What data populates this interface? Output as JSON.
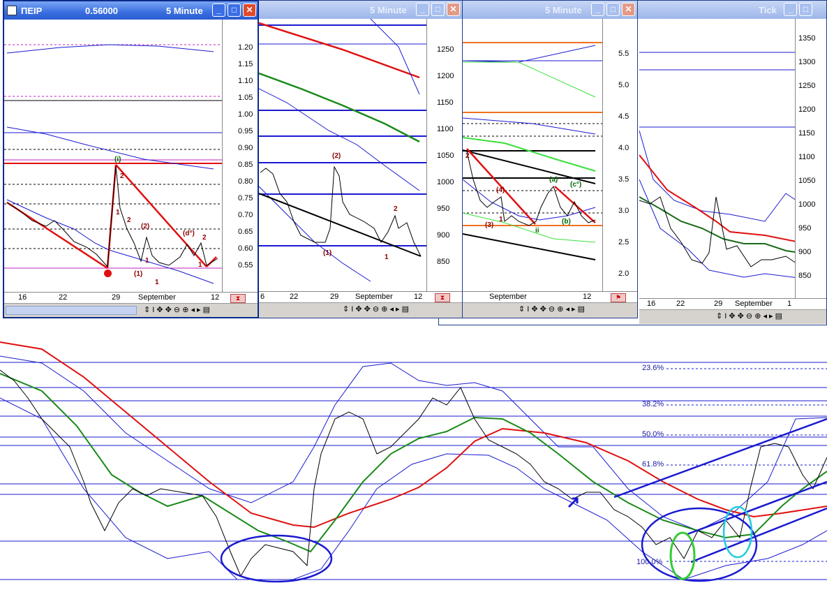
{
  "windows": [
    {
      "title": "ΠΕΙΡ",
      "price": "0.56000",
      "interval": "5 Minute",
      "yaxis": [
        "1.20",
        "1.15",
        "1.10",
        "1.05",
        "1.00",
        "0.95",
        "0.90",
        "0.85",
        "0.80",
        "0.75",
        "0.70",
        "0.65",
        "0.60",
        "0.55"
      ],
      "xaxis": [
        "16",
        "22",
        "29",
        "September",
        "12"
      ],
      "waves": [
        "(i)",
        "2",
        "1",
        "2",
        "(2)",
        "1",
        "(1)",
        "1",
        "(d°)",
        "2",
        "1"
      ]
    },
    {
      "title": "",
      "interval": "5 Minute",
      "yaxis": [
        "1250",
        "1200",
        "1150",
        "1100",
        "1050",
        "1000",
        "950",
        "900",
        "850"
      ],
      "xaxis": [
        "6",
        "22",
        "29",
        "September",
        "12"
      ],
      "waves": [
        "(2)",
        "2",
        "(1)",
        "1"
      ]
    },
    {
      "title": "",
      "interval": "5 Minute",
      "yaxis": [
        "5.5",
        "5.0",
        "4.5",
        "4.0",
        "3.5",
        "3.0",
        "2.5",
        "2.0"
      ],
      "xaxis": [
        "September",
        "12"
      ],
      "waves": [
        "2",
        "(4)",
        "1",
        "(3)",
        "ii",
        "(a)",
        "(c°)",
        "(b)"
      ]
    },
    {
      "title": "",
      "interval": "Tick",
      "yaxis": [
        "1350",
        "1300",
        "1250",
        "1200",
        "1150",
        "1100",
        "1050",
        "1000",
        "950",
        "900",
        "850"
      ],
      "xaxis": [
        "16",
        "22",
        "29",
        "September",
        "1"
      ],
      "waves": []
    }
  ],
  "main": {
    "fib_levels": [
      "23.6%",
      "38.2%",
      "50.0%",
      "61.8%",
      "100.0%"
    ]
  },
  "colors": {
    "title_active": "#2a5bd0",
    "ma_red": "#e01010",
    "ma_green": "#1a8a1a",
    "band_blue": "#1a1ad0",
    "price": "#000000"
  }
}
